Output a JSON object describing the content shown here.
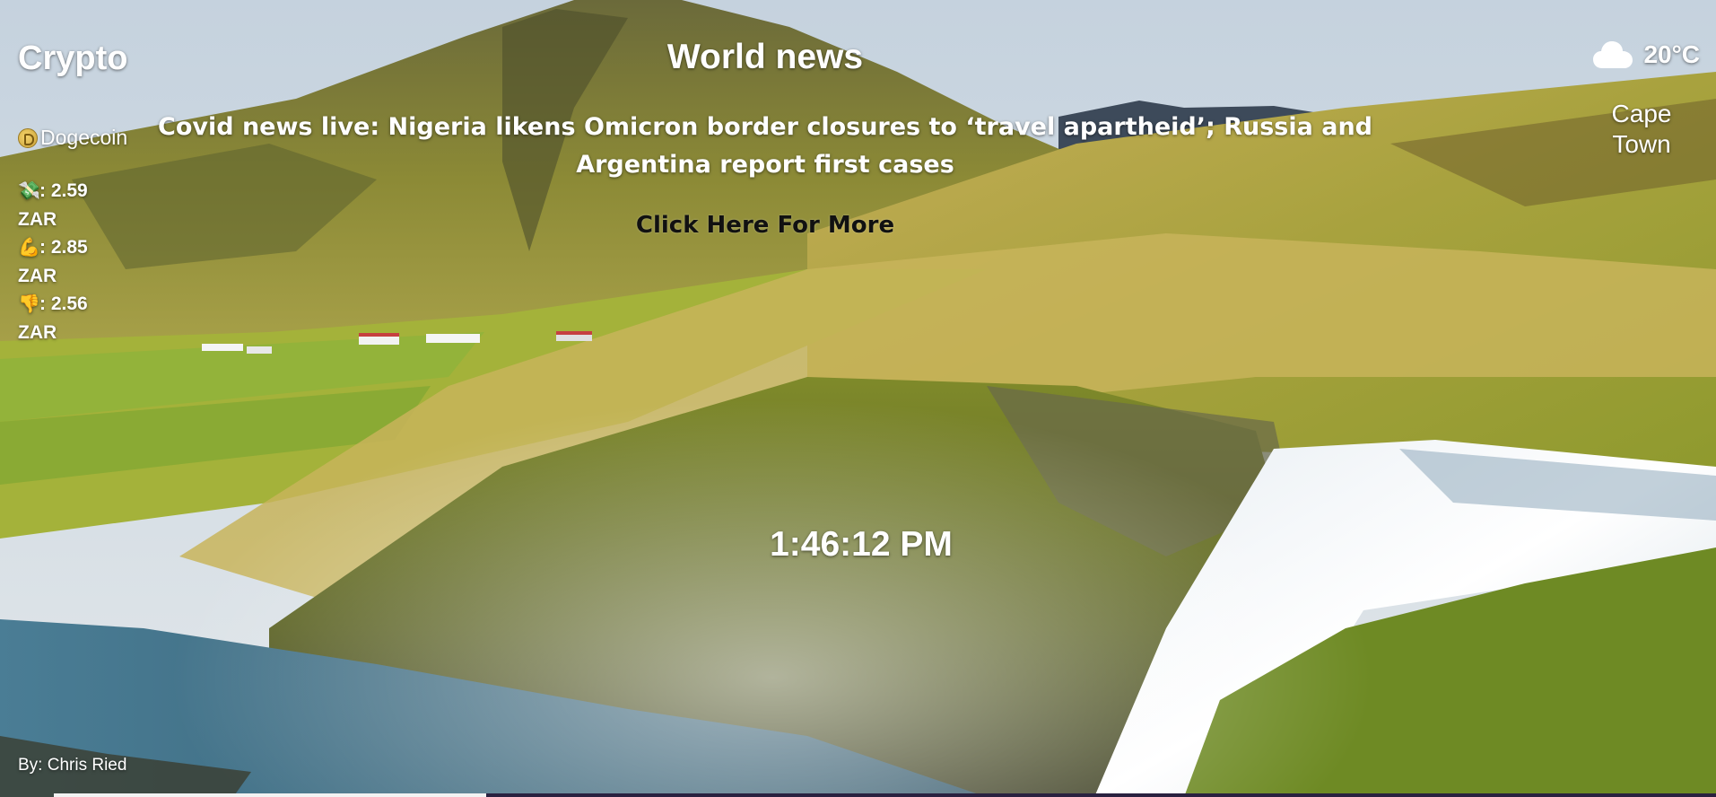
{
  "crypto": {
    "title": "Crypto",
    "coin": {
      "name": "Dogecoin",
      "icon": "dogecoin-icon"
    },
    "prices": [
      {
        "icon": "money-icon",
        "emoji": "💸",
        "value": ": 2.59",
        "currency": "ZAR"
      },
      {
        "icon": "flexed-biceps-icon",
        "emoji": "💪",
        "value": ": 2.85",
        "currency": "ZAR"
      },
      {
        "icon": "thumbs-down-icon",
        "emoji": "👎",
        "value": ": 2.56",
        "currency": "ZAR"
      }
    ]
  },
  "news": {
    "title": "World news",
    "headline": "Covid news live: Nigeria likens Omicron border closures to ‘travel apartheid’; Russia and Argentina report first cases",
    "more_label": "Click Here For More"
  },
  "weather": {
    "icon": "cloud-icon",
    "temperature": "20°C",
    "city": "Cape Town"
  },
  "clock": {
    "time": "1:46:12 PM"
  },
  "footer": {
    "author": "By: Chris Ried"
  },
  "colors": {
    "text": "#ffffff",
    "link": "#111111",
    "sky": "#c9d6e2",
    "grass": "#8f9e2c",
    "water": "#3f6f86"
  }
}
